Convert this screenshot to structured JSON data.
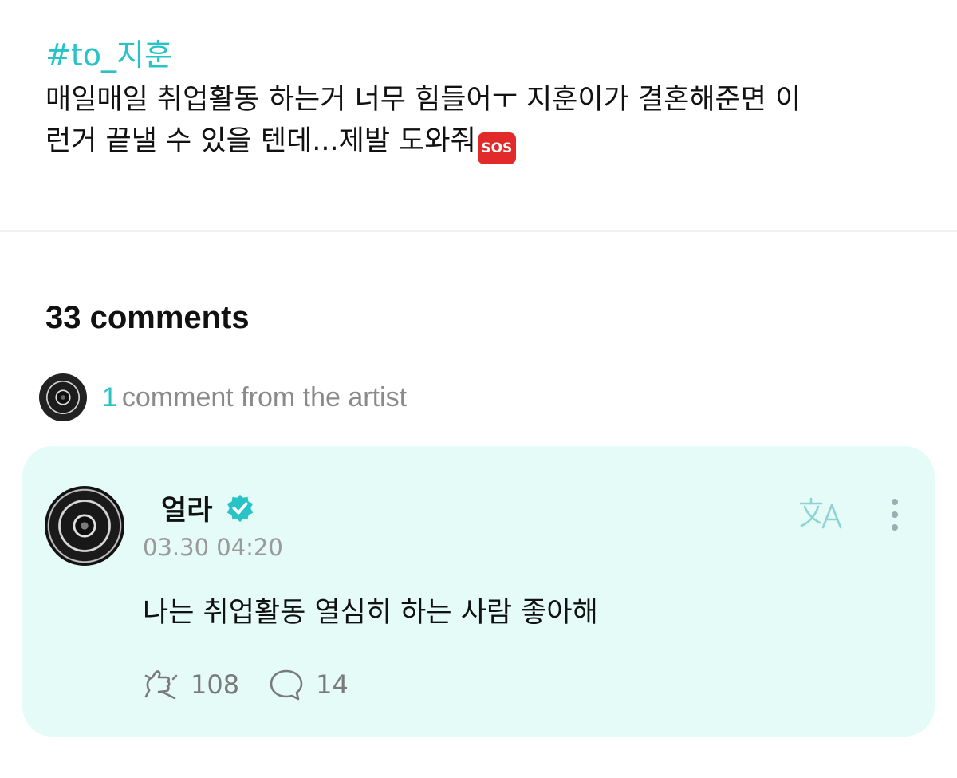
{
  "post": {
    "hashtag": "#to_지훈",
    "body_line1": "매일매일 취업활동 하는거 너무 힘들어ㅜ 지훈이가 결혼해준면 이",
    "body_line2": "런거 끝낼 수 있을 텐데...제발 도와줘",
    "sos_badge": "SOS"
  },
  "comments": {
    "count_title": "33 comments",
    "artist_count": "1",
    "artist_label": "comment from the artist"
  },
  "artist_comment": {
    "author": "얼라",
    "verified_icon": "verified-badge-icon",
    "timestamp": "03.30 04:20",
    "text": "나는 취업활동 열심히 하는 사람 좋아해",
    "likes": "108",
    "replies": "14"
  },
  "colors": {
    "accent": "#27c3c7",
    "card_bg": "#e5fbf7",
    "muted": "#8a8a8a"
  }
}
